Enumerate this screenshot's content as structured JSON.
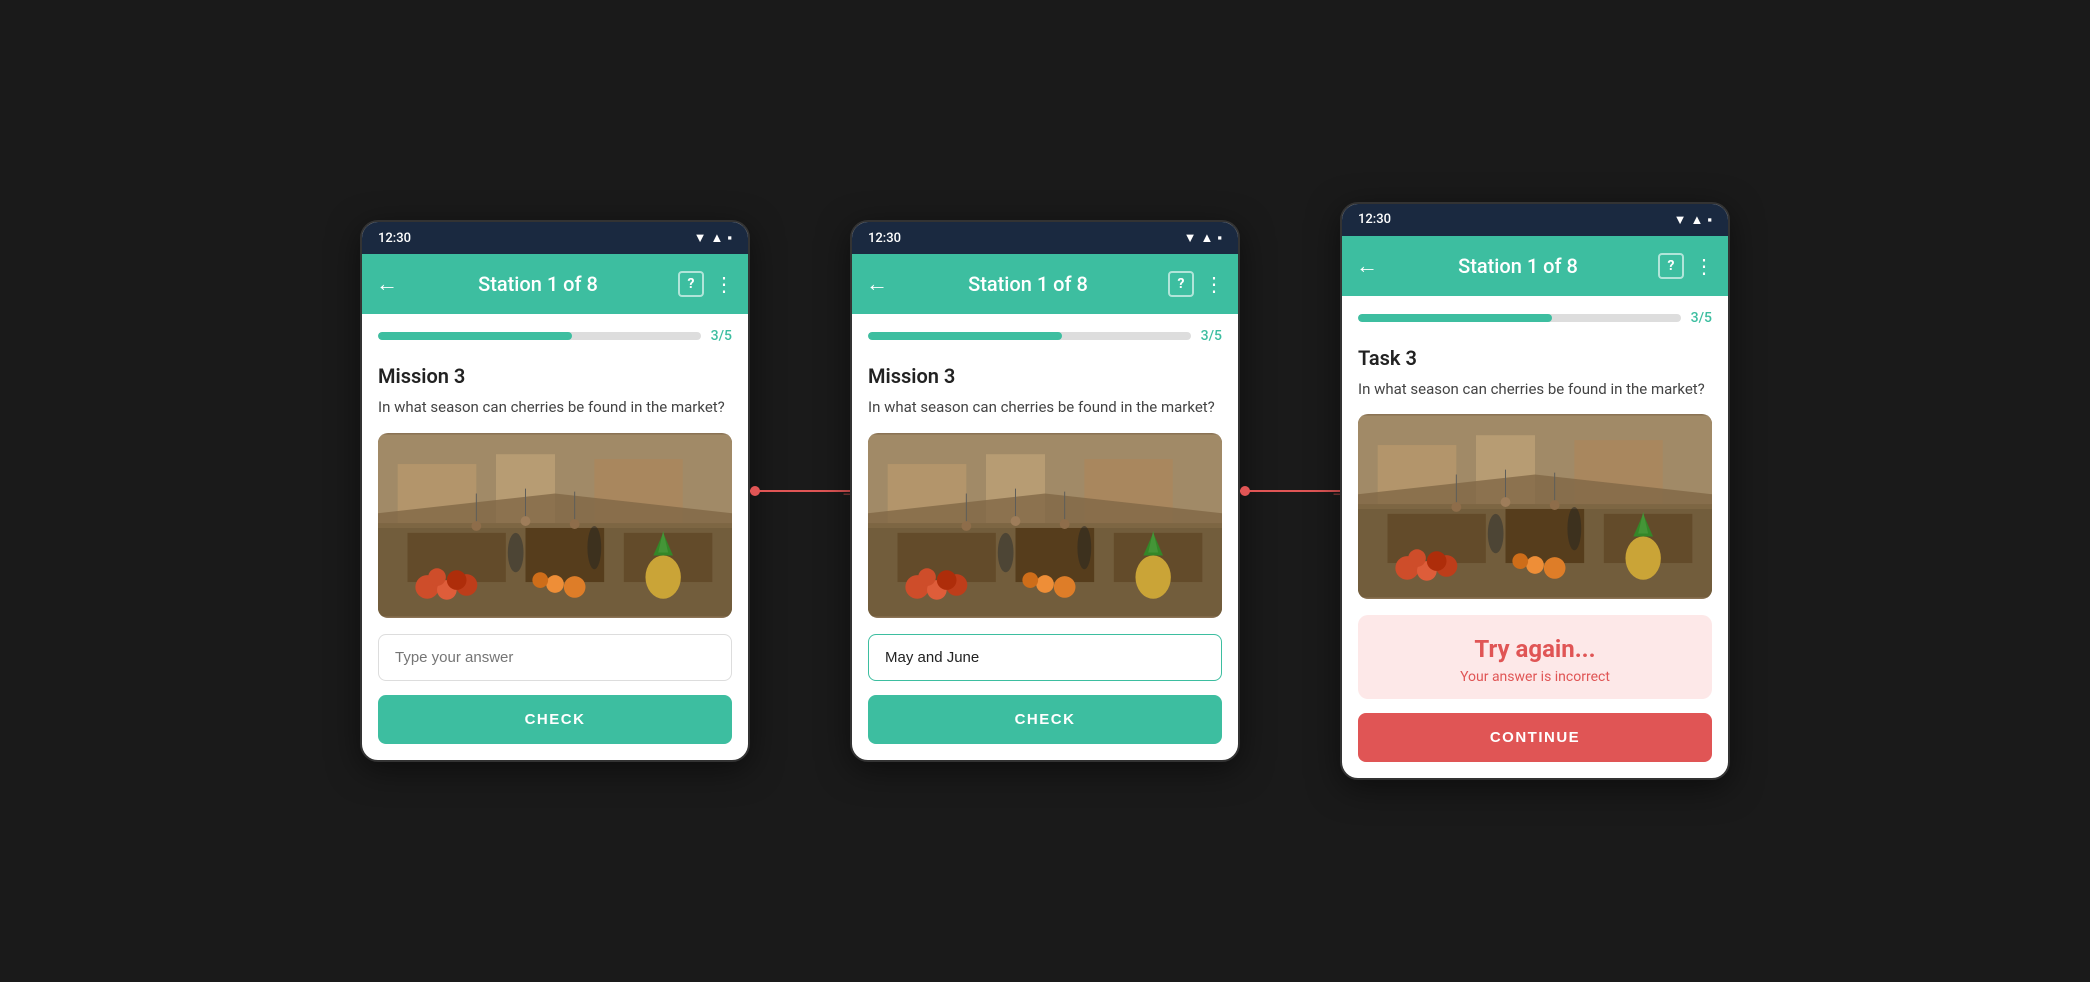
{
  "phones": [
    {
      "id": "phone1",
      "status_time": "12:30",
      "app_bar_title": "Station 1 of 8",
      "progress_percent": 60,
      "progress_label": "3/5",
      "mission_title": "Mission 3",
      "question": "In what season can cherries be found in the market?",
      "input_placeholder": "Type your answer",
      "input_value": "",
      "show_try_again": false,
      "try_again_title": "",
      "try_again_sub": "",
      "button_label": "CHECK",
      "button_type": "check"
    },
    {
      "id": "phone2",
      "status_time": "12:30",
      "app_bar_title": "Station 1 of 8",
      "progress_percent": 60,
      "progress_label": "3/5",
      "mission_title": "Mission 3",
      "question": "In what season can cherries be found in the market?",
      "input_placeholder": "",
      "input_value": "May and June",
      "show_try_again": false,
      "try_again_title": "",
      "try_again_sub": "",
      "button_label": "CHECK",
      "button_type": "check"
    },
    {
      "id": "phone3",
      "status_time": "12:30",
      "app_bar_title": "Station 1 of 8",
      "progress_percent": 60,
      "progress_label": "3/5",
      "mission_title": "Task 3",
      "question": "In what season can cherries be found in the market?",
      "input_placeholder": "",
      "input_value": "",
      "show_try_again": true,
      "try_again_title": "Try again...",
      "try_again_sub": "Your answer is incorrect",
      "button_label": "CONTINUE",
      "button_type": "continue"
    }
  ],
  "connector": {
    "arrow": "→"
  }
}
